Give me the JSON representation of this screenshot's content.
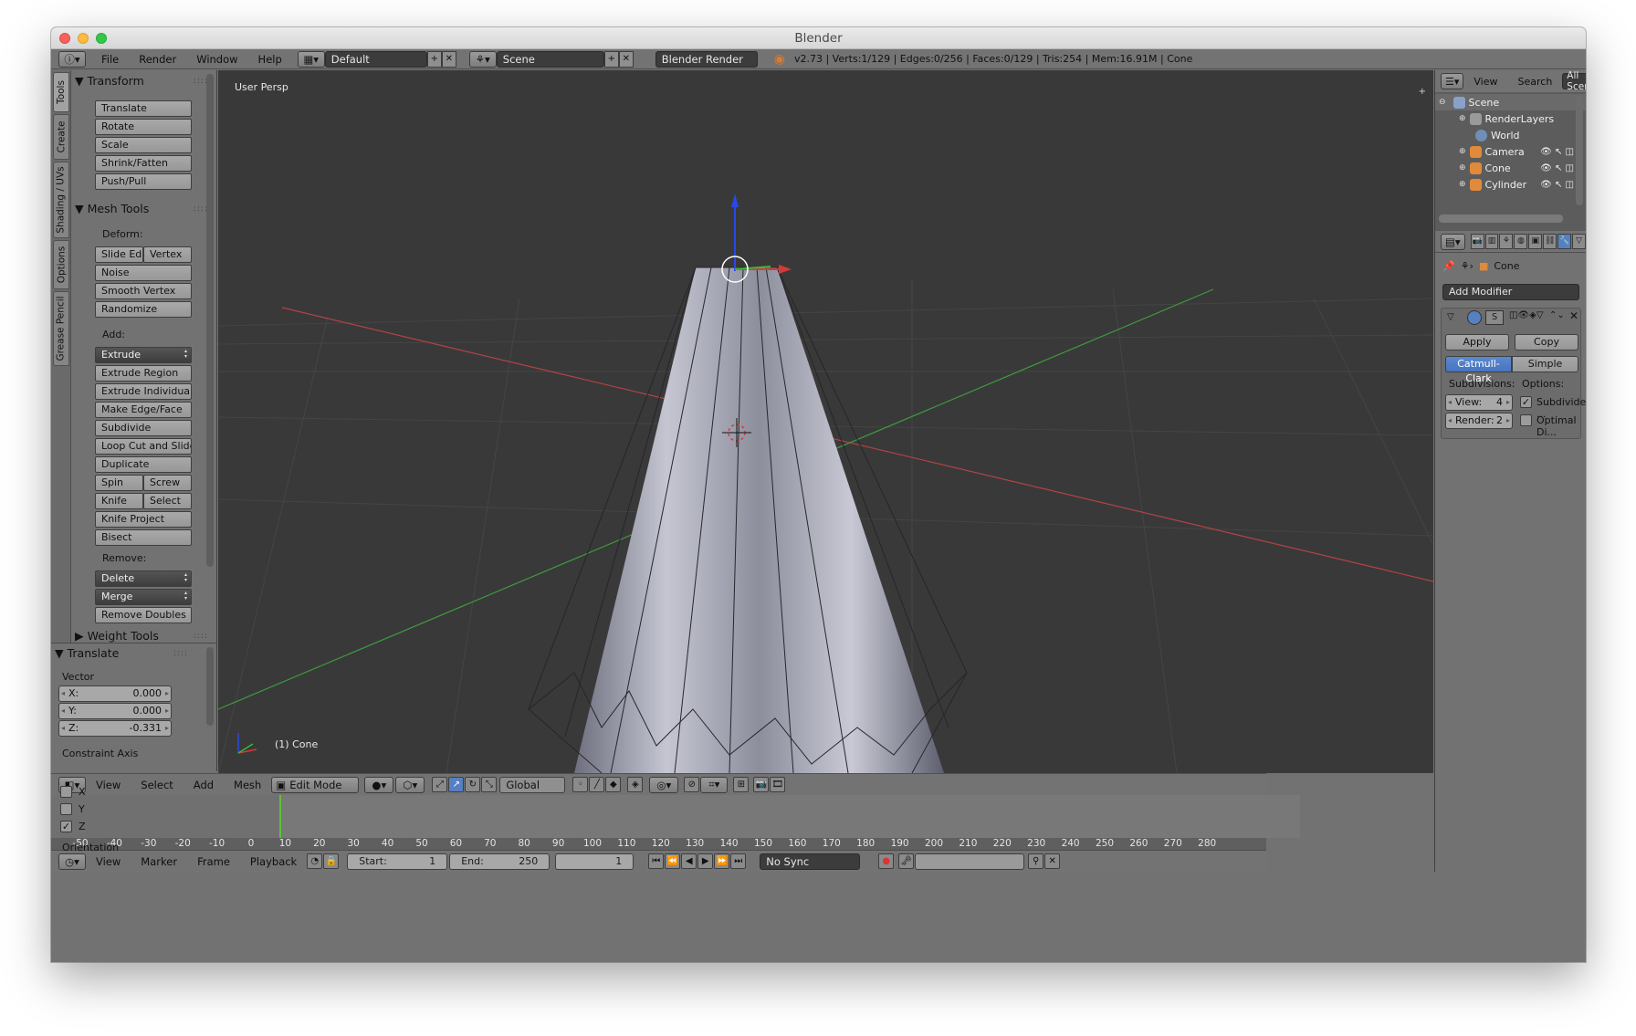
{
  "window": {
    "title": "Blender"
  },
  "infobar": {
    "menu": [
      "File",
      "Render",
      "Window",
      "Help"
    ],
    "layout": "Default",
    "scene": "Scene",
    "engine": "Blender Render",
    "stats": "v2.73 | Verts:1/129 | Edges:0/256 | Faces:0/129 | Tris:254 | Mem:16.91M | Cone"
  },
  "tool_tabs": [
    "Tools",
    "Create",
    "Shading / UVs",
    "Options",
    "Grease Pencil"
  ],
  "toolshelf": {
    "transform": {
      "title": "Transform",
      "buttons": [
        "Translate",
        "Rotate",
        "Scale",
        "Shrink/Fatten",
        "Push/Pull"
      ]
    },
    "mesh_tools": {
      "title": "Mesh Tools",
      "deform_label": "Deform:",
      "slide_edge": "Slide Ed",
      "vertex": "Vertex",
      "noise": "Noise",
      "smooth_vertex": "Smooth Vertex",
      "randomize": "Randomize",
      "add_label": "Add:",
      "extrude": "Extrude",
      "extrude_region": "Extrude Region",
      "extrude_individual": "Extrude Individual",
      "make_edge_face": "Make Edge/Face",
      "subdivide": "Subdivide",
      "loop_cut": "Loop Cut and Slide",
      "duplicate": "Duplicate",
      "spin": "Spin",
      "screw": "Screw",
      "knife": "Knife",
      "select": "Select",
      "knife_project": "Knife Project",
      "bisect": "Bisect",
      "remove_label": "Remove:",
      "delete": "Delete",
      "merge": "Merge",
      "remove_doubles": "Remove Doubles"
    },
    "weight_tools": {
      "title": "Weight Tools"
    }
  },
  "operator": {
    "title": "Translate",
    "vector_label": "Vector",
    "x_label": "X:",
    "x": "0.000",
    "y_label": "Y:",
    "y": "0.000",
    "z_label": "Z:",
    "z": "-0.331",
    "constraint_label": "Constraint Axis",
    "axes": [
      "X",
      "Y",
      "Z"
    ],
    "axes_checked": [
      false,
      false,
      true
    ],
    "orientation_label": "Orientation"
  },
  "viewport": {
    "view_name": "User Persp",
    "object_label": "(1) Cone"
  },
  "view3d_header": {
    "menu": [
      "View",
      "Select",
      "Add",
      "Mesh"
    ],
    "mode": "Edit Mode",
    "orientation": "Global"
  },
  "timeline": {
    "ticks": [
      "-50",
      "-40",
      "-30",
      "-20",
      "-10",
      "0",
      "10",
      "20",
      "30",
      "40",
      "50",
      "60",
      "70",
      "80",
      "90",
      "100",
      "110",
      "120",
      "130",
      "140",
      "150",
      "160",
      "170",
      "180",
      "190",
      "200",
      "210",
      "220",
      "230",
      "240",
      "250",
      "260",
      "270",
      "280"
    ],
    "current_frame_value": 0,
    "menu": [
      "View",
      "Marker",
      "Frame",
      "Playback"
    ],
    "start_label": "Start:",
    "start": "1",
    "end_label": "End:",
    "end": "250",
    "frame": "1",
    "sync": "No Sync"
  },
  "outliner": {
    "menu": [
      "View",
      "Search"
    ],
    "display": "All Scenes",
    "items": [
      "Scene",
      "RenderLayers",
      "World",
      "Camera",
      "Cone",
      "Cylinder"
    ]
  },
  "properties": {
    "context": "Cone",
    "add_modifier": "Add Modifier",
    "modifier_short": "S",
    "apply": "Apply",
    "copy": "Copy",
    "mode_a": "Catmull-Clark",
    "mode_b": "Simple",
    "subdivisions_label": "Subdivisions:",
    "options_label": "Options:",
    "view_label": "View:",
    "view_value": "4",
    "render_label": "Render:",
    "render_value": "2",
    "subdivide_uvs": "Subdivide ...",
    "optimal_display": "Optimal Di..."
  },
  "colors": {
    "accent": "#5680c2",
    "viewport_bg": "#393939",
    "x_axis": "#d23b3b",
    "y_axis": "#39b839",
    "z_axis": "#2a48e6",
    "timeline_cursor": "#5ac33a"
  }
}
